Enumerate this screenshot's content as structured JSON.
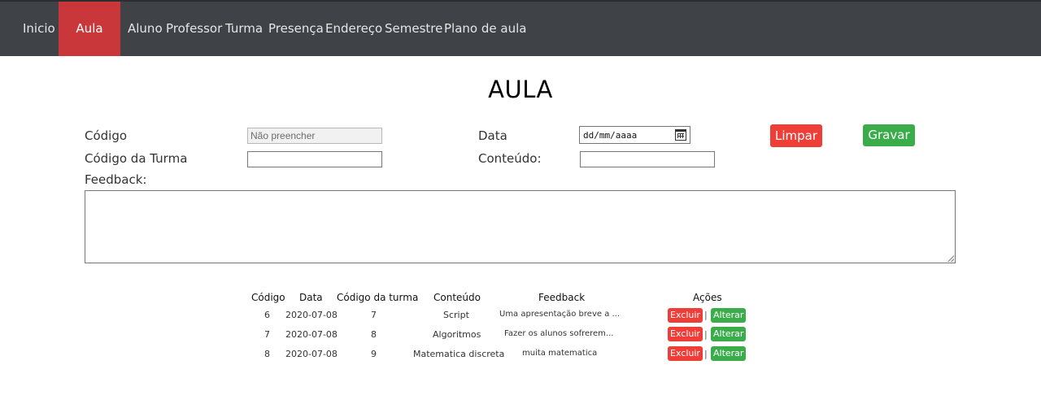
{
  "nav": {
    "items": [
      {
        "label": "Inicio"
      },
      {
        "label": "Aula"
      },
      {
        "label": "Aluno"
      },
      {
        "label": "Professor"
      },
      {
        "label": "Turma"
      },
      {
        "label": "Presença"
      },
      {
        "label": "Endereço"
      },
      {
        "label": "Semestre"
      },
      {
        "label": "Plano de aula"
      }
    ],
    "active": "Aula"
  },
  "page": {
    "title": "AULA"
  },
  "form": {
    "codigo_label": "Código",
    "codigo_placeholder": "Não preencher",
    "codigo_turma_label": "Código da Turma",
    "codigo_turma_value": "",
    "feedback_label": "Feedback:",
    "feedback_value": "",
    "data_label": "Data",
    "data_placeholder": "dd/mm/aaaa",
    "conteudo_label": "Conteúdo:",
    "conteudo_value": "",
    "limpar_label": "Limpar",
    "gravar_label": "Gravar"
  },
  "table": {
    "headers": [
      "Código",
      "Data",
      "Código da turma",
      "Conteúdo",
      "Feedback",
      "Ações"
    ],
    "rows": [
      {
        "codigo": "6",
        "data": "2020-07-08",
        "turma": "7",
        "conteudo": "Script",
        "feedback": "Uma apresentação breve a ..."
      },
      {
        "codigo": "7",
        "data": "2020-07-08",
        "turma": "8",
        "conteudo": "Algoritmos",
        "feedback": "Fazer os alunos sofrerem..."
      },
      {
        "codigo": "8",
        "data": "2020-07-08",
        "turma": "9",
        "conteudo": "Matematica discreta",
        "feedback": "muita matematica"
      }
    ],
    "excluir_label": "Excluir",
    "alterar_label": "Alterar",
    "separator": "|"
  },
  "colors": {
    "navbar": "#3f4246",
    "nav_active": "#c9373a",
    "danger": "#ef3e38",
    "success": "#3aad4a"
  }
}
